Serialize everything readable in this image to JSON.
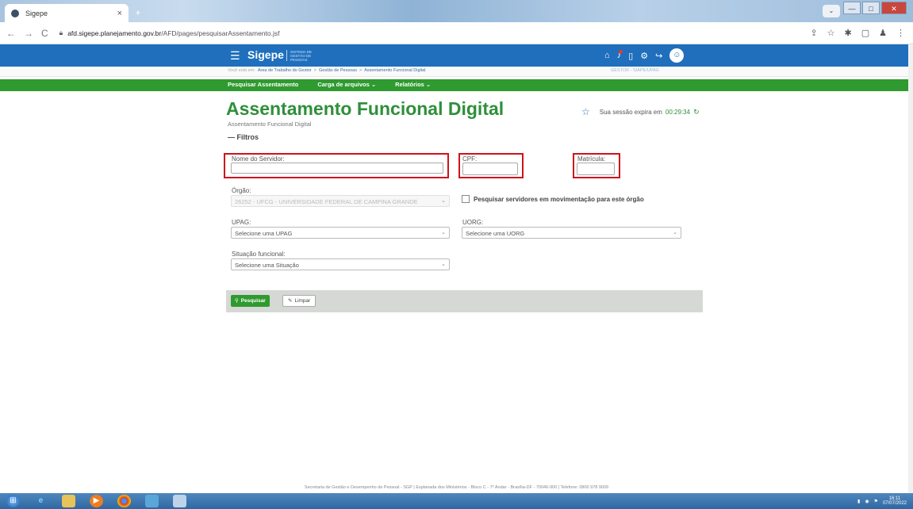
{
  "browser": {
    "tab_title": "Sigepe",
    "tab_close": "×",
    "new_tab": "+",
    "url_host": "afd.sigepe.planejamento.gov.br",
    "url_path": "/AFD/pages/pesquisarAssentamento.jsf",
    "nav_back": "←",
    "nav_forward": "→",
    "nav_reload": "C",
    "win_min": "—",
    "win_max": "□",
    "win_close": "✕"
  },
  "header": {
    "brand": "Sigepe",
    "brand_sub": "SISTEMA DE GESTÃO DE PESSOAS"
  },
  "breadcrumb": {
    "here": "Você está em:",
    "items": [
      "Área de Trabalho do Gestor",
      "Gestão de Pessoas",
      "Assentamento Funcional Digital"
    ],
    "separator": ">",
    "user_role": "GESTOR - SIAPE/UPAG"
  },
  "main_nav": [
    "Pesquisar Assentamento",
    "Carga de arquivos ⌄",
    "Relatórios ⌄"
  ],
  "page": {
    "title": "Assentamento Funcional Digital",
    "subtitle": "Assentamento Funcional Digital",
    "session_text": "Sua sessão expira em",
    "session_timer": "00:29:34",
    "filters_label": "— Filtros"
  },
  "form": {
    "nome_label": "Nome do Servidor:",
    "cpf_label": "CPF:",
    "matricula_label": "Matrícula:",
    "orgao_label": "Órgão:",
    "orgao_value": "26252 - UFCG - UNIVERSIDADE FEDERAL DE CAMPINA GRANDE",
    "checkbox_label": "Pesquisar servidores em movimentação para este órgão",
    "upag_label": "UPAG:",
    "upag_value": "Selecione uma UPAG",
    "uorg_label": "UORG:",
    "uorg_value": "Selecione uma UORG",
    "situacao_label": "Situação funcional:",
    "situacao_value": "Selecione uma Situação",
    "search_button": "Pesquisar",
    "clear_button": "Limpar"
  },
  "footer": {
    "text": "Secretaria de Gestão e Desempenho de Pessoal - SGP | Esplanada dos Ministérios - Bloco C - 7º Andar - Brasília-DF - 70046-900 | Telefone: 0800 978 9009"
  },
  "taskbar": {
    "clock_time": "16:11",
    "clock_date": "07/07/2022"
  },
  "colors": {
    "header_blue": "#1f6fbd",
    "nav_green": "#2f9a2f",
    "title_green": "#2f8f3a",
    "highlight_red": "#d0121b"
  }
}
